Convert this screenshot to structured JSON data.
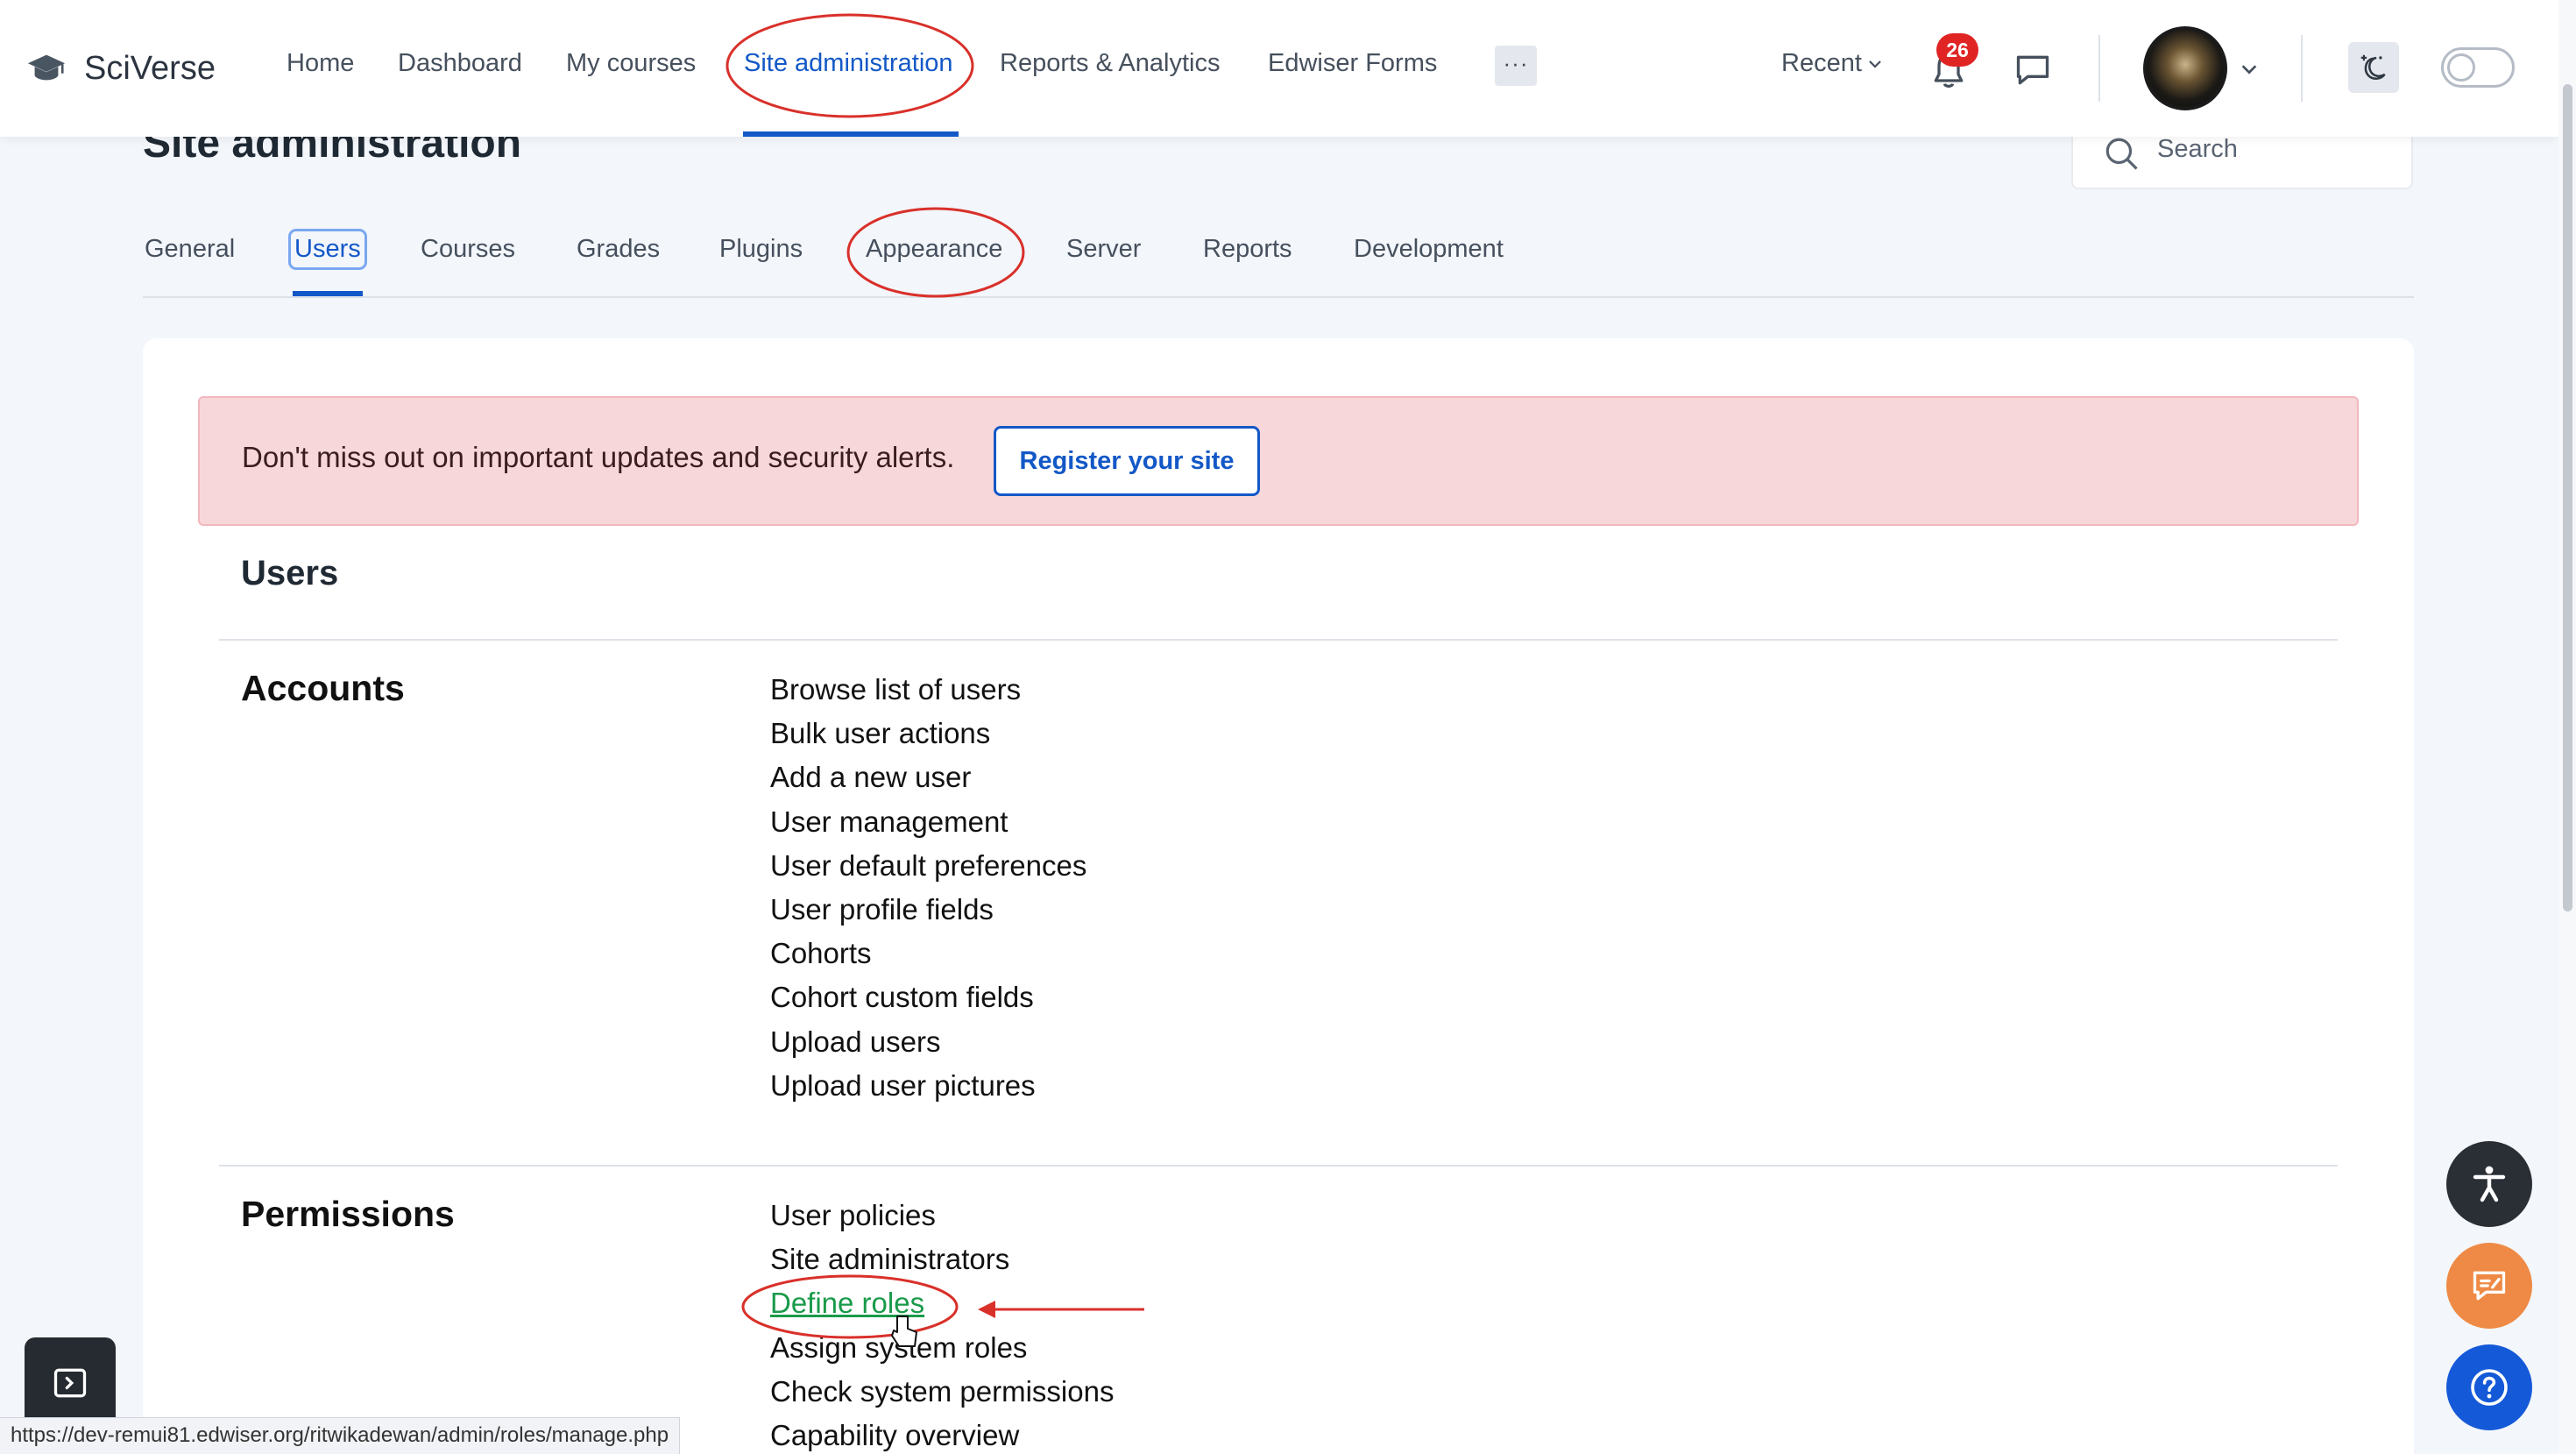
{
  "brand": {
    "name": "SciVerse",
    "icon": "graduation-cap-icon"
  },
  "nav": {
    "items": [
      {
        "label": "Home"
      },
      {
        "label": "Dashboard"
      },
      {
        "label": "My courses"
      },
      {
        "label": "Site administration",
        "active": true
      },
      {
        "label": "Reports & Analytics"
      },
      {
        "label": "Edwiser Forms"
      }
    ],
    "more_label": "···",
    "recent_label": "Recent",
    "notification_count": "26",
    "accent_color": "#1358c7"
  },
  "page": {
    "title": "Site administration",
    "search_label": "Search"
  },
  "tabs": [
    {
      "label": "General"
    },
    {
      "label": "Users",
      "active": true
    },
    {
      "label": "Courses"
    },
    {
      "label": "Grades"
    },
    {
      "label": "Plugins"
    },
    {
      "label": "Appearance"
    },
    {
      "label": "Server"
    },
    {
      "label": "Reports"
    },
    {
      "label": "Development"
    }
  ],
  "alert": {
    "text": "Don't miss out on important updates and security alerts.",
    "button_label": "Register your site",
    "color": "#f8d7da"
  },
  "section": {
    "title": "Users",
    "groups": [
      {
        "title": "Accounts",
        "links": [
          "Browse list of users",
          "Bulk user actions",
          "Add a new user",
          "User management",
          "User default preferences",
          "User profile fields",
          "Cohorts",
          "Cohort custom fields",
          "Upload users",
          "Upload user pictures"
        ]
      },
      {
        "title": "Permissions",
        "links": [
          "User policies",
          "Site administrators",
          "Define roles",
          "Assign system roles",
          "Check system permissions",
          "Capability overview"
        ]
      }
    ]
  },
  "status_bar_url": "https://dev-remui81.edwiser.org/ritwikadewan/admin/roles/manage.php",
  "annotation_color": "#d9302a"
}
